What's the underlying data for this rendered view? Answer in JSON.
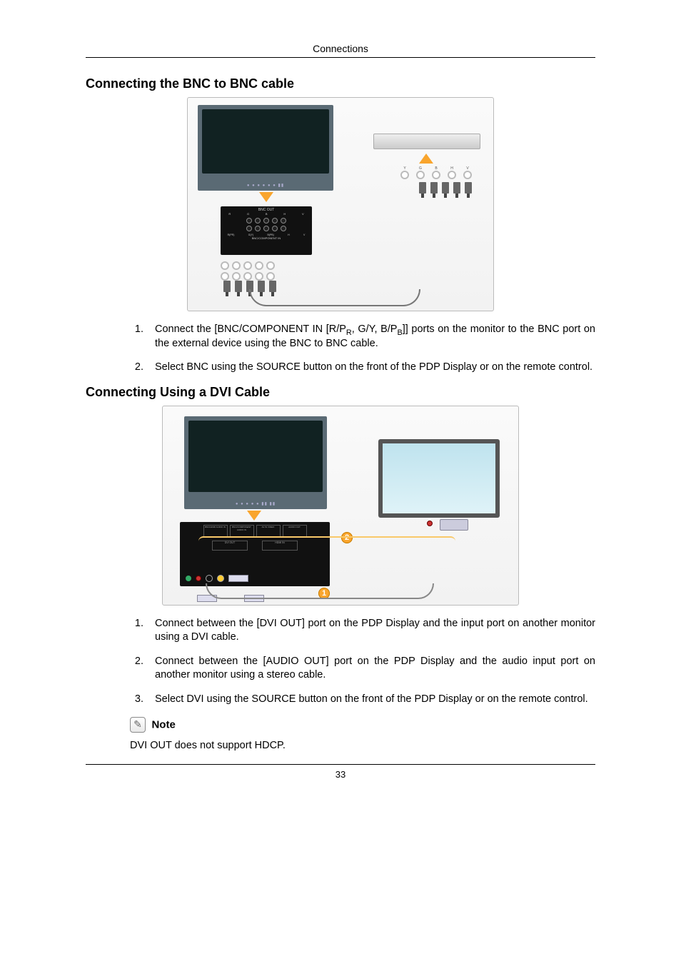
{
  "runhead": "Connections",
  "section1": {
    "heading": "Connecting the BNC to BNC cable",
    "figure": {
      "ext_labels": [
        "Y",
        "G",
        "B",
        "H",
        "V"
      ],
      "panel_group_label": "BNC OUT",
      "panel_bottom_label": "BNC/COMPONENT IN",
      "col_labels_top": [
        "R",
        "G",
        "B",
        "H",
        "V"
      ],
      "col_labels_bottom": [
        "R(PR)",
        "G(Y)",
        "B(PB)",
        "H",
        "V"
      ]
    },
    "steps": [
      {
        "prefix": "Connect the [BNC/COMPONENT IN [R/P",
        "sub1": "R",
        "mid": ", G/Y, B/P",
        "sub2": "B",
        "suffix": "]] ports on the monitor to the BNC port on the external device using the BNC to BNC cable."
      },
      {
        "text": "Select BNC using the SOURCE button on the front of the PDP Display or on the remote control."
      }
    ]
  },
  "section2": {
    "heading": "Connecting Using a DVI Cable",
    "figure": {
      "panel_labels": [
        "BNC/HDMI AUDIO IN",
        "BNC/COMPONENT AUDIO IN",
        "AV IN VIDEO",
        "AUDIO OUT",
        "DVI OUT",
        "HDMI IN"
      ],
      "badge1": "1",
      "badge2": "2"
    },
    "steps": [
      {
        "text": "Connect between the [DVI OUT] port on the PDP Display and the input port on another monitor using a DVI cable."
      },
      {
        "text": "Connect between the [AUDIO OUT] port on the PDP Display and the audio input port on another monitor using a stereo cable."
      },
      {
        "text": "Select DVI using the SOURCE button on the front of the PDP Display or on the remote control."
      }
    ],
    "note_label": "Note",
    "note_text": "DVI OUT does not support HDCP."
  },
  "pagenum": "33"
}
